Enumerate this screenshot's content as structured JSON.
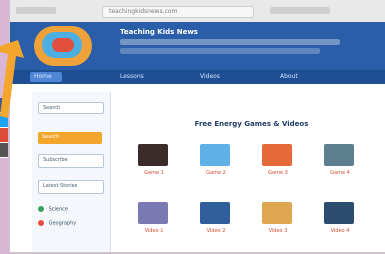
{
  "browser": {
    "tab_title": "Teaching Kids News",
    "address": "teachingkidsnews.com"
  },
  "site": {
    "title": "Teaching Kids News",
    "nav": [
      "Home",
      "Lessons",
      "Videos",
      "About"
    ]
  },
  "sidebar": {
    "search_label": "Search",
    "search_button": "Search",
    "button_2": "Subscribe",
    "button_3": "Latest Stories",
    "items": [
      "Science",
      "Geography"
    ]
  },
  "main": {
    "section_title": "Free Energy Games & Videos",
    "cards": [
      {
        "caption": "Game 1"
      },
      {
        "caption": "Game 2"
      },
      {
        "caption": "Game 3"
      },
      {
        "caption": "Game 4"
      },
      {
        "caption": "Video 1"
      },
      {
        "caption": "Video 2"
      },
      {
        "caption": "Video 3"
      },
      {
        "caption": "Video 4"
      }
    ]
  },
  "colors": {
    "brand_blue": "#2a5ea8",
    "accent_orange": "#f3a62b",
    "caption_red": "#d64b2b"
  }
}
